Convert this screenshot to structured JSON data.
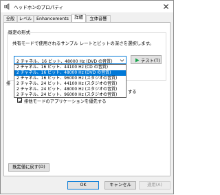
{
  "window": {
    "title": "ヘッドホンのプロパティ"
  },
  "tabs": [
    {
      "label": "全般",
      "active": false
    },
    {
      "label": "レベル",
      "active": false
    },
    {
      "label": "Enhancements",
      "active": false
    },
    {
      "label": "詳細",
      "active": true
    },
    {
      "label": "立体音響",
      "active": false
    }
  ],
  "default_format": {
    "group_label": "既定の形式",
    "description": "共有モードで使用されるサンプル レートとビットの深さを選択します。",
    "selected_value": "2 チャネル、16 ビット、48000 Hz (DVD の音質)",
    "test_button_label": "テスト(T)",
    "options": [
      "2 チャネル、16 ビット、44100 Hz (CD の音質)",
      "2 チャネル、16 ビット、48000 Hz (DVD の音質)",
      "2 チャネル、16 ビット、96000 Hz (スタジオの音質)",
      "2 チャネル、24 ビット、44100 Hz (スタジオの音質)",
      "2 チャネル、24 ビット、48000 Hz (スタジオの音質)",
      "2 チャネル、24 ビット、96000 Hz (スタジオの音質)"
    ],
    "highlighted_index": 1
  },
  "exclusive_mode": {
    "group_label_fragment": "排",
    "option1_fragment": "する",
    "option2_label": "排他モードのアプリケーションを優先する",
    "option1_checked": true,
    "option2_checked": true
  },
  "restore_defaults_label": "既定値に戻す(D)",
  "buttons": {
    "ok": "OK",
    "cancel": "キャンセル",
    "apply": "適用(A)"
  },
  "colors": {
    "accent": "#0078d7",
    "highlight": "#0078d7",
    "test_icon": "#16a34a"
  }
}
